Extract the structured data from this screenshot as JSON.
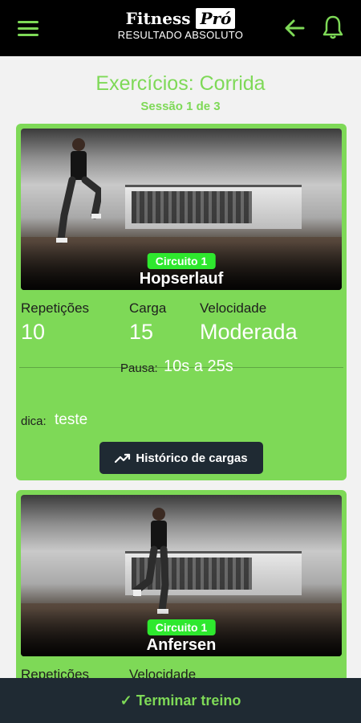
{
  "header": {
    "logo_main": "Fitness",
    "logo_pro": "Pró",
    "logo_sub": "RESULTADO ABSOLUTO",
    "icons": [
      "menu-icon",
      "arrow-left-icon",
      "bell-icon"
    ],
    "accent_color": "#7ed957"
  },
  "page": {
    "title": "Exercícios: Corrida",
    "subtitle": "Sessão 1 de 3"
  },
  "exercises": [
    {
      "circuit": "Circuito 1",
      "name": "Hopserlauf",
      "stats": [
        {
          "label": "Repetições",
          "value": "10"
        },
        {
          "label": "Carga",
          "value": "15"
        },
        {
          "label": "Velocidade",
          "value": "Moderada"
        }
      ],
      "pause_label": "Pausa:",
      "pause_value": "10s a 25s",
      "tip_label": "dica:",
      "tip_value": "teste",
      "history_button": "Histórico de cargas"
    },
    {
      "circuit": "Circuito 1",
      "name": "Anfersen",
      "stats": [
        {
          "label": "Repetições",
          "value": ""
        },
        {
          "label": "Velocidade",
          "value": ""
        }
      ]
    }
  ],
  "footer": {
    "finish_label": "✓ Terminar treino"
  },
  "colors": {
    "card": "#7ed957",
    "badge": "#2ee82e",
    "dark_button": "#1f2a33"
  }
}
